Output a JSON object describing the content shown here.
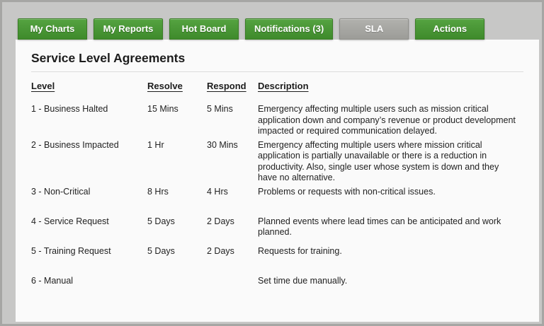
{
  "colors": {
    "background_gray": "#c7c7c6",
    "panel_background": "#fafafa",
    "tab_green_top": "#55a341",
    "tab_green_bottom": "#3e8a2b",
    "tab_green_border": "#3a7d26",
    "tab_active_gray": "#a5a5a1",
    "tab_text": "#ffffff",
    "body_text": "#222222"
  },
  "tabs": [
    {
      "label": "My Charts",
      "active": false
    },
    {
      "label": "My Reports",
      "active": false
    },
    {
      "label": "Hot Board",
      "active": false
    },
    {
      "label": "Notifications (3)",
      "active": false
    },
    {
      "label": "SLA",
      "active": true
    },
    {
      "label": "Actions",
      "active": false
    }
  ],
  "panel": {
    "title": "Service Level Agreements",
    "table": {
      "headers": [
        "Level",
        "Resolve",
        "Respond",
        "Description"
      ],
      "rows": [
        {
          "level": "1 - Business Halted",
          "resolve": "15 Mins",
          "respond": "5 Mins",
          "description": "Emergency affecting multiple users such as mission critical application down and company’s revenue or product development impacted or required communication delayed."
        },
        {
          "level": "2 - Business Impacted",
          "resolve": "1 Hr",
          "respond": "30 Mins",
          "description": "Emergency affecting multiple users where mission critical application is partially unavailable or there is a reduction in productivity. Also, single user whose system is down and they have no alternative."
        },
        {
          "level": "3 - Non-Critical",
          "resolve": "8 Hrs",
          "respond": "4 Hrs",
          "description": "Problems or requests with non-critical issues."
        },
        {
          "level": "4 - Service Request",
          "resolve": "5 Days",
          "respond": "2 Days",
          "description": "Planned events where lead times can be anticipated and work planned."
        },
        {
          "level": "5 - Training Request",
          "resolve": "5 Days",
          "respond": "2 Days",
          "description": "Requests for training."
        },
        {
          "level": "6 - Manual",
          "resolve": "",
          "respond": "",
          "description": "Set time due manually."
        }
      ]
    }
  }
}
